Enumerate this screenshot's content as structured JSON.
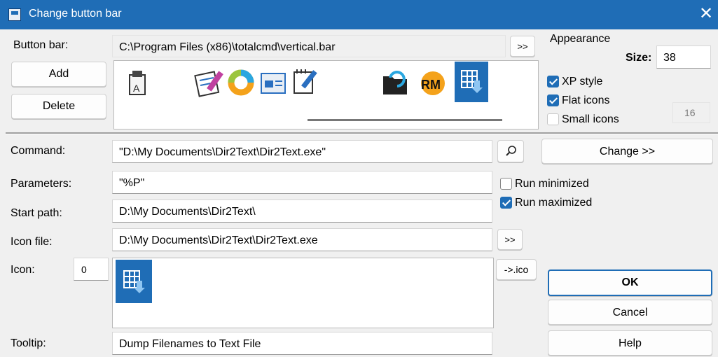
{
  "window": {
    "title": "Change button bar",
    "close": "✕"
  },
  "buttonbar": {
    "label": "Button bar:",
    "path": "C:\\Program Files (x86)\\totalcmd\\vertical.bar",
    "browse": ">>",
    "add": "Add",
    "delete": "Delete",
    "icons": [
      "clipboard-a-icon",
      "notepad-icon",
      "ring-icon",
      "id-card-icon",
      "edit-note-icon",
      "folder-refresh-icon",
      "rm-icon",
      "dump-grid-icon"
    ]
  },
  "appearance": {
    "title": "Appearance",
    "size_label": "Size:",
    "size_value": "38",
    "xp_style": "XP style",
    "flat_icons": "Flat icons",
    "small_icons": "Small icons",
    "small_size": "16",
    "xp_checked": true,
    "flat_checked": true,
    "small_checked": false
  },
  "command": {
    "label": "Command:",
    "value": "\"D:\\My Documents\\Dir2Text\\Dir2Text.exe\"",
    "change": "Change >>"
  },
  "parameters": {
    "label": "Parameters:",
    "value": "\"%P\""
  },
  "run": {
    "minimized": "Run minimized",
    "maximized": "Run maximized",
    "minimized_checked": false,
    "maximized_checked": true
  },
  "startpath": {
    "label": "Start path:",
    "value": "D:\\My Documents\\Dir2Text\\"
  },
  "iconfile": {
    "label": "Icon file:",
    "value": "D:\\My Documents\\Dir2Text\\Dir2Text.exe",
    "browse": ">>"
  },
  "icon": {
    "label": "Icon:",
    "index": "0",
    "to_ico": "->.ico"
  },
  "tooltip": {
    "label": "Tooltip:",
    "value": "Dump Filenames to Text File"
  },
  "buttons": {
    "ok": "OK",
    "cancel": "Cancel",
    "help": "Help"
  }
}
